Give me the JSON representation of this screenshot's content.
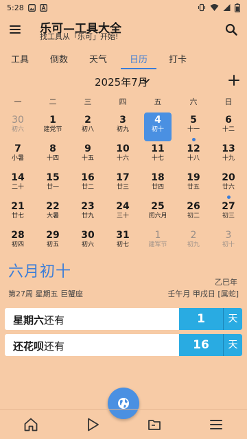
{
  "status_bar": {
    "time": "5:28",
    "icons": [
      "image-icon",
      "a-box-icon"
    ],
    "right_icons": [
      "vibrate-icon",
      "wifi-icon",
      "signal-icon",
      "battery-icon"
    ]
  },
  "app_bar": {
    "title": "乐可—工具大全",
    "subtitle": "找工具从「乐可」开始!",
    "icons": [
      "menu-icon",
      "search-icon"
    ]
  },
  "tabs": [
    {
      "label": "工具"
    },
    {
      "label": "倒数"
    },
    {
      "label": "天气"
    },
    {
      "label": "日历",
      "active": true
    },
    {
      "label": "打卡"
    }
  ],
  "calendar": {
    "month_label": "2025年7月",
    "weekdays": [
      "一",
      "二",
      "三",
      "四",
      "五",
      "六",
      "日"
    ],
    "days": [
      {
        "n": "30",
        "l": "初六",
        "other": true
      },
      {
        "n": "1",
        "l": "建党节"
      },
      {
        "n": "2",
        "l": "初八"
      },
      {
        "n": "3",
        "l": "初九"
      },
      {
        "n": "4",
        "l": "初十",
        "today": true
      },
      {
        "n": "5",
        "l": "十一",
        "dot": true
      },
      {
        "n": "6",
        "l": "十二"
      },
      {
        "n": "7",
        "l": "小暑"
      },
      {
        "n": "8",
        "l": "十四"
      },
      {
        "n": "9",
        "l": "十五"
      },
      {
        "n": "10",
        "l": "十六"
      },
      {
        "n": "11",
        "l": "十七"
      },
      {
        "n": "12",
        "l": "十八"
      },
      {
        "n": "13",
        "l": "十九"
      },
      {
        "n": "14",
        "l": "二十"
      },
      {
        "n": "15",
        "l": "廿一"
      },
      {
        "n": "16",
        "l": "廿二"
      },
      {
        "n": "17",
        "l": "廿三"
      },
      {
        "n": "18",
        "l": "廿四"
      },
      {
        "n": "19",
        "l": "廿五"
      },
      {
        "n": "20",
        "l": "廿六",
        "dot": true
      },
      {
        "n": "21",
        "l": "廿七"
      },
      {
        "n": "22",
        "l": "大暑"
      },
      {
        "n": "23",
        "l": "廿九"
      },
      {
        "n": "24",
        "l": "三十"
      },
      {
        "n": "25",
        "l": "闰六月"
      },
      {
        "n": "26",
        "l": "初二"
      },
      {
        "n": "27",
        "l": "初三"
      },
      {
        "n": "28",
        "l": "初四"
      },
      {
        "n": "29",
        "l": "初五"
      },
      {
        "n": "30",
        "l": "初六"
      },
      {
        "n": "31",
        "l": "初七"
      },
      {
        "n": "1",
        "l": "建军节",
        "other": true
      },
      {
        "n": "2",
        "l": "初九",
        "other": true
      },
      {
        "n": "3",
        "l": "初十",
        "other": true
      }
    ]
  },
  "detail": {
    "lunar_date": "六月初十",
    "ganzhi_year": "乙巳年",
    "week_info": "第27周  星期五  巨蟹座",
    "ganzhi_full": "壬午月 甲戌日 [属蛇]"
  },
  "countdowns": [
    {
      "name_bold": "星期六",
      "suffix": "还有",
      "value": "1",
      "unit": "天"
    },
    {
      "name_bold": "还花呗",
      "suffix": "还有",
      "value": "16",
      "unit": "天"
    }
  ],
  "bottom_nav": [
    "home-icon",
    "play-icon",
    "folder-icon",
    "list-icon"
  ],
  "colors": {
    "background": "#F7CBA6",
    "accent": "#3B7DD8",
    "today_bg": "#4A90E2",
    "countdown_value_bg": "#29ABE2",
    "card_bg": "#FFFFFF"
  }
}
